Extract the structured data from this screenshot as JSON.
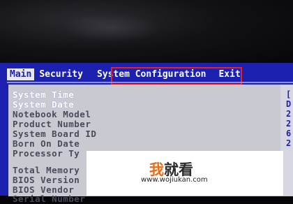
{
  "menu": {
    "items": [
      {
        "label": "Main",
        "active": true
      },
      {
        "label": "Security",
        "active": false
      },
      {
        "label": "System Configuration",
        "active": false,
        "highlighted": true
      },
      {
        "label": "Exit",
        "active": false
      }
    ]
  },
  "fields": {
    "system_time": "System Time",
    "system_date": "System Date",
    "notebook_model": "Notebook Model",
    "product_number": "Product Number",
    "system_board_id": "System Board ID",
    "born_on_date": "Born On Date",
    "processor_type": "Processor Ty",
    "total_memory": "Total Memory",
    "bios_version": "BIOS Version",
    "bios_vendor": "BIOS Vendor",
    "serial_number": "Serial Number"
  },
  "right_values": [
    "[",
    "D",
    "2",
    "2",
    "6",
    "2"
  ],
  "watermark": {
    "brand_part1": "我",
    "brand_part2": "就看",
    "url": "www.wojiukan.com"
  },
  "colors": {
    "bios_blue": "#1c21b0",
    "panel_gray": "#c9c9d2",
    "highlight_red": "#e0232c",
    "brand_orange": "#f06a12"
  }
}
